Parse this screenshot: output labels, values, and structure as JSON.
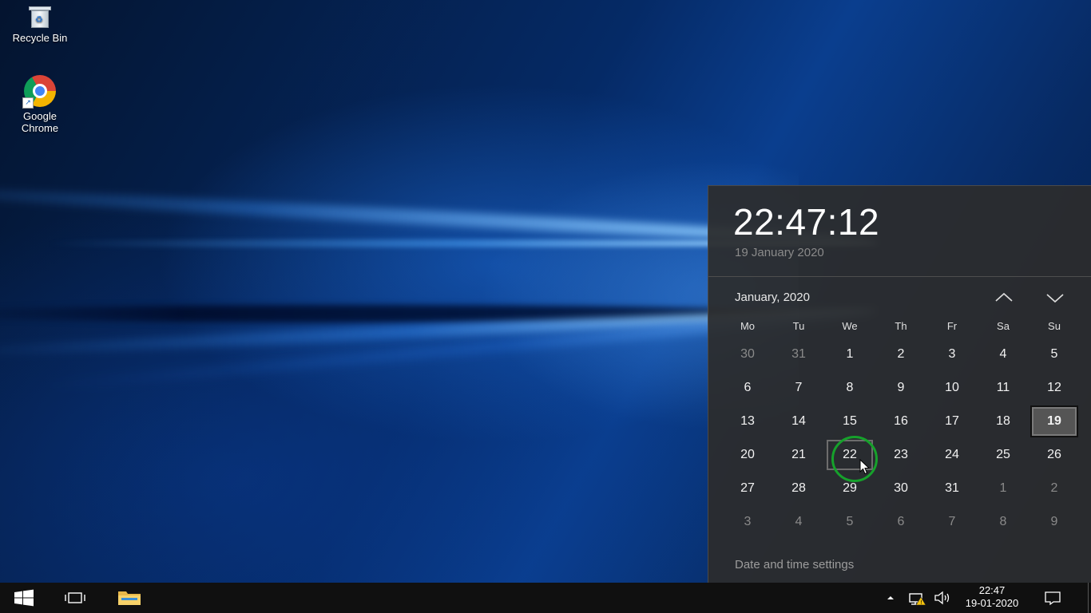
{
  "desktop": {
    "icons": [
      {
        "label": "Recycle Bin",
        "icon": "recycle-bin-icon"
      },
      {
        "label": "Google\nChrome",
        "icon": "chrome-icon"
      }
    ]
  },
  "flyout": {
    "time": "22:47:12",
    "date_long": "19 January 2020",
    "month_label": "January, 2020",
    "weekdays": [
      "Mo",
      "Tu",
      "We",
      "Th",
      "Fr",
      "Sa",
      "Su"
    ],
    "weeks": [
      [
        "30",
        "31",
        "1",
        "2",
        "3",
        "4",
        "5"
      ],
      [
        "6",
        "7",
        "8",
        "9",
        "10",
        "11",
        "12"
      ],
      [
        "13",
        "14",
        "15",
        "16",
        "17",
        "18",
        "19"
      ],
      [
        "20",
        "21",
        "22",
        "23",
        "24",
        "25",
        "26"
      ],
      [
        "27",
        "28",
        "29",
        "30",
        "31",
        "1",
        "2"
      ],
      [
        "3",
        "4",
        "5",
        "6",
        "7",
        "8",
        "9"
      ]
    ],
    "today": "19",
    "hovered": "22",
    "settings_link": "Date and time settings"
  },
  "taskbar": {
    "clock_time": "22:47",
    "clock_date": "19-01-2020"
  },
  "colors": {
    "highlight_ring": "#16a12b",
    "flyout_bg": "#2c2c2c",
    "taskbar_bg": "#101010"
  }
}
